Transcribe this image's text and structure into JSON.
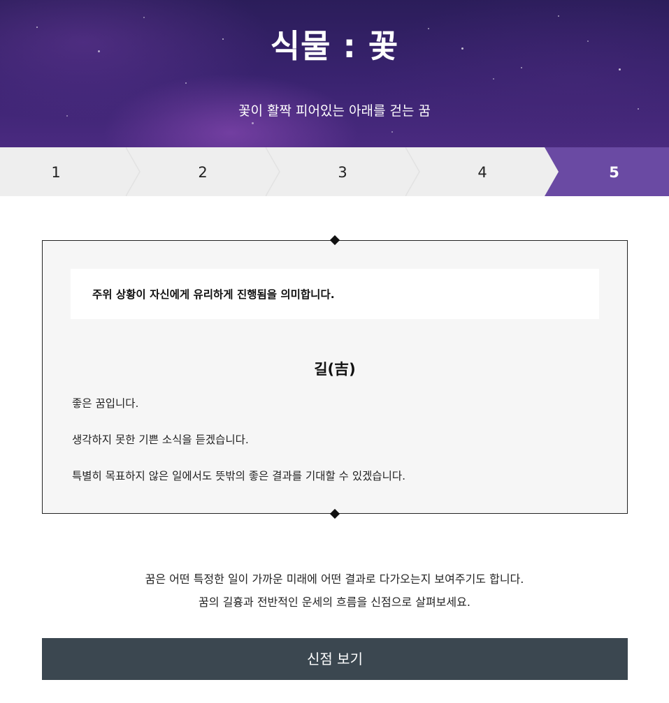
{
  "header": {
    "title": "식물 : 꽃",
    "subtitle": "꽃이 활짝 피어있는 아래를 걷는 꿈"
  },
  "steps": {
    "items": [
      "1",
      "2",
      "3",
      "4",
      "5"
    ],
    "active": "5"
  },
  "result": {
    "summary": "주위 상황이 자신에게 유리하게 진행됨을 의미합니다.",
    "verdict": "길(吉)",
    "details": [
      "좋은 꿈입니다.",
      "생각하지 못한 기쁜 소식을 듣겠습니다.",
      "특별히 목표하지 않은 일에서도 뜻밖의 좋은 결과를 기대할 수 있겠습니다."
    ]
  },
  "notice": {
    "line1": "꿈은 어떤 특정한 일이 가까운 미래에 어떤 결과로 다가오는지 보여주기도 합니다.",
    "line2": "꿈의 길흉과 전반적인 운세의 흐름을 신점으로 살펴보세요."
  },
  "cta": {
    "label": "신점 보기"
  },
  "colors": {
    "accent": "#6a4aa3",
    "cta_background": "#3b4750",
    "step_background": "#eeeeee",
    "box_background": "#f6f6f6"
  }
}
